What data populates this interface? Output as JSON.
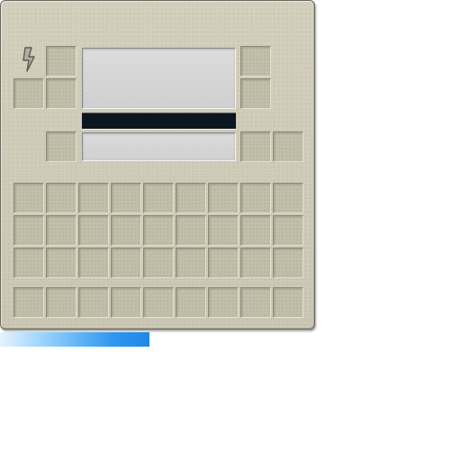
{
  "machine": {
    "icon": "lightning-bolt-icon",
    "upper_slots": 7,
    "inventory_rows": 3,
    "inventory_cols": 9,
    "hotbar_slots": 9
  },
  "energy": {
    "fraction": 0.325,
    "color": "#2f98f0"
  }
}
